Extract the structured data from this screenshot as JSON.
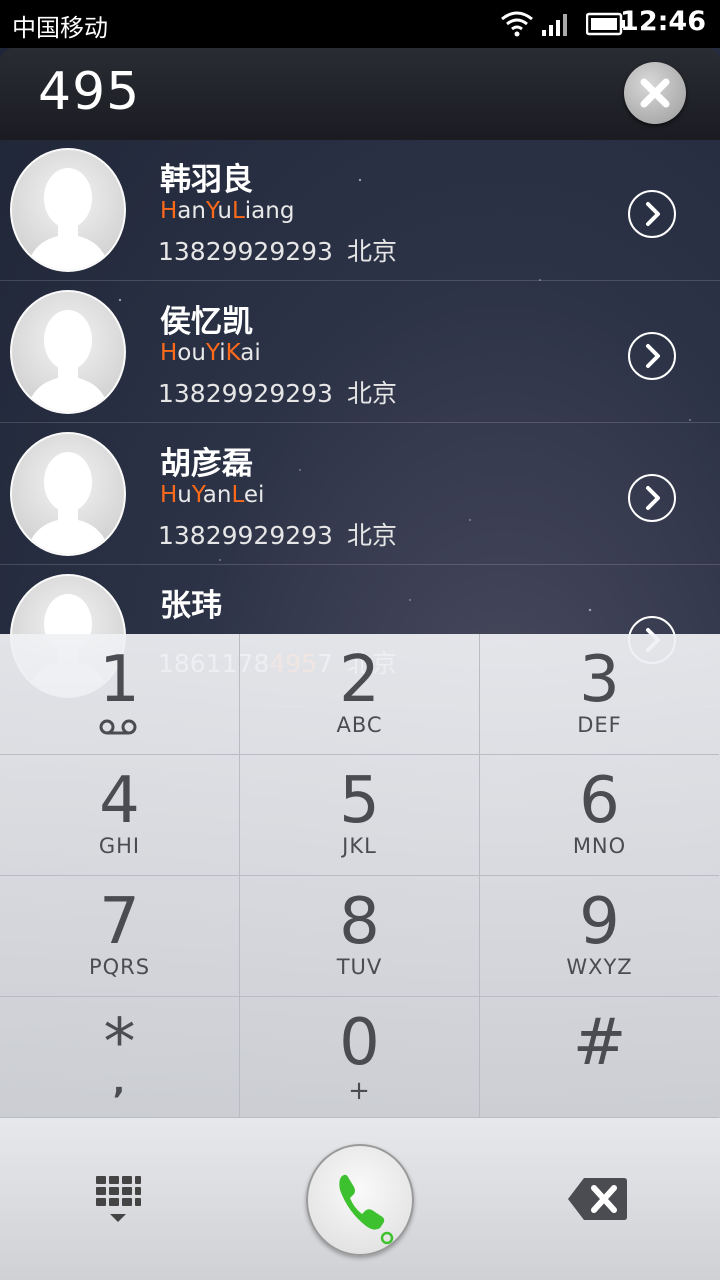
{
  "status_bar": {
    "carrier": "中国移动",
    "time": "12:46",
    "icons": [
      "wifi-icon",
      "signal-icon",
      "battery-icon"
    ]
  },
  "dial": {
    "number": "495"
  },
  "contacts": [
    {
      "name": "韩羽良",
      "pinyin": [
        {
          "t": "H",
          "hl": true
        },
        {
          "t": "an",
          "hl": false
        },
        {
          "t": "Y",
          "hl": true
        },
        {
          "t": "u",
          "hl": false
        },
        {
          "t": "L",
          "hl": true
        },
        {
          "t": "iang",
          "hl": false
        }
      ],
      "phone": "13829929293",
      "location": "北京"
    },
    {
      "name": "侯忆凯",
      "pinyin": [
        {
          "t": "H",
          "hl": true
        },
        {
          "t": "ou",
          "hl": false
        },
        {
          "t": "Y",
          "hl": true
        },
        {
          "t": "i",
          "hl": false
        },
        {
          "t": "K",
          "hl": true
        },
        {
          "t": "ai",
          "hl": false
        }
      ],
      "phone": "13829929293",
      "location": "北京"
    },
    {
      "name": "胡彦磊",
      "pinyin": [
        {
          "t": "H",
          "hl": true
        },
        {
          "t": "u",
          "hl": false
        },
        {
          "t": "Y",
          "hl": true
        },
        {
          "t": "an",
          "hl": false
        },
        {
          "t": "L",
          "hl": true
        },
        {
          "t": "ei",
          "hl": false
        }
      ],
      "phone": "13829929293",
      "location": "北京"
    },
    {
      "name": "张玮",
      "phone_parts": [
        {
          "t": "186117",
          "hl": false
        },
        {
          "t": "8",
          "hl": false
        },
        {
          "t": "495",
          "hl": true
        },
        {
          "t": "7",
          "hl": false
        }
      ],
      "location": "北京"
    }
  ],
  "keypad": {
    "keys": [
      {
        "digit": "1",
        "sub": "voicemail-icon"
      },
      {
        "digit": "2",
        "sub": "ABC"
      },
      {
        "digit": "3",
        "sub": "DEF"
      },
      {
        "digit": "4",
        "sub": "GHI"
      },
      {
        "digit": "5",
        "sub": "JKL"
      },
      {
        "digit": "6",
        "sub": "MNO"
      },
      {
        "digit": "7",
        "sub": "PQRS"
      },
      {
        "digit": "8",
        "sub": "TUV"
      },
      {
        "digit": "9",
        "sub": "WXYZ"
      },
      {
        "digit": "*",
        "sub": ","
      },
      {
        "digit": "0",
        "sub": "+"
      },
      {
        "digit": "#",
        "sub": ""
      }
    ]
  },
  "bottom_bar": {
    "icons": [
      "dialpad-toggle-icon",
      "call-icon",
      "backspace-icon"
    ]
  },
  "colors": {
    "highlight": "#ff6a1a",
    "call_green": "#3ec12f"
  }
}
